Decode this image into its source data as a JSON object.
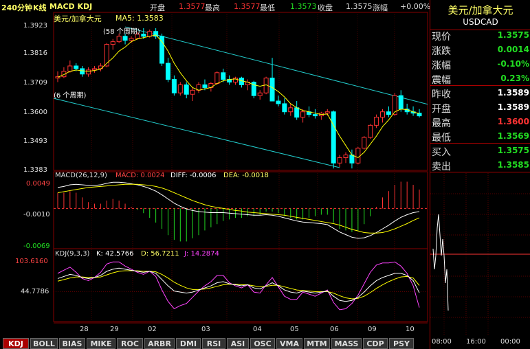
{
  "header": {
    "period": "240分钟",
    "kline": "K线",
    "indicators": "MACD KDJ",
    "open_label": "开盘",
    "open_value": "1.3577",
    "high_label": "最高",
    "high_value": "1.3577",
    "low_label": "最低",
    "low_value": "1.3573",
    "close_label": "收盘",
    "close_value": "1.3575",
    "change_label": "涨幅",
    "change_value": "+0.00%"
  },
  "main_panel": {
    "symbol_name": "美元/加拿大元",
    "ma_label": "MA5: 1.3583",
    "channel_top_label": "(58 个周期)",
    "channel_bottom_label": "(6 个周期)",
    "y_ticks": [
      "1.3923",
      "1.3816",
      "1.3709",
      "1.3600",
      "1.3493",
      "1.3383"
    ]
  },
  "macd_panel": {
    "title": "MACD(26,12,9)",
    "macd": "MACD: 0.0024",
    "diff": "DIFF: -0.0006",
    "dea": "DEA: -0.0018",
    "y_ticks": [
      "0.0049",
      "-0.0010",
      "-0.0069"
    ]
  },
  "kdj_panel": {
    "title": "KDJ(9,3,3)",
    "k": "K: 42.5766",
    "d": "D: 56.7211",
    "j": "J: 14.2874",
    "y_ticks": [
      "103.6160",
      "44.7786"
    ]
  },
  "x_axis": [
    "28",
    "29",
    "02",
    "03",
    "04",
    "05",
    "06",
    "09",
    "10"
  ],
  "quote": {
    "name": "美元/加拿大元",
    "code": "USDCAD",
    "rows": [
      {
        "label": "现价",
        "value": "1.3575",
        "color": "#22dd22"
      },
      {
        "label": "涨跌",
        "value": "0.0014",
        "color": "#22dd22"
      },
      {
        "label": "涨幅",
        "value": "-0.10%",
        "color": "#22dd22"
      },
      {
        "label": "震幅",
        "value": "0.23%",
        "color": "#22dd22"
      },
      {
        "label": "昨收",
        "value": "1.3589",
        "color": "#ffffff"
      },
      {
        "label": "开盘",
        "value": "1.3589",
        "color": "#ffffff"
      },
      {
        "label": "最高",
        "value": "1.3600",
        "color": "#ff3333"
      },
      {
        "label": "最低",
        "value": "1.3569",
        "color": "#22dd22"
      },
      {
        "label": "买入",
        "value": "1.3575",
        "color": "#22dd22"
      },
      {
        "label": "卖出",
        "value": "1.3585",
        "color": "#22dd22"
      }
    ],
    "time_labels": [
      "08:00",
      "16:00",
      "00:00"
    ]
  },
  "tabs": [
    "KDJ",
    "BOLL",
    "BIAS",
    "MIKE",
    "ROC",
    "ARBR",
    "DMI",
    "RSI",
    "ASI",
    "OSC",
    "VMA",
    "MTM",
    "MASS",
    "CDP",
    "PSY"
  ],
  "active_tab": "KDJ",
  "colors": {
    "up": "#ff3333",
    "down": "#00ffff",
    "ma": "#ffff00",
    "channel": "#22cccc",
    "macd_pos": "#ff3333",
    "macd_neg": "#22dd22",
    "diff": "#ffffff",
    "dea": "#ffff00",
    "k": "#ffffff",
    "d": "#ffff00",
    "j": "#ff44ff",
    "grid": "#880000"
  },
  "chart_data": {
    "type": "candlestick",
    "candles": [
      [
        1.3715,
        1.374,
        1.37,
        1.372
      ],
      [
        1.372,
        1.3755,
        1.3715,
        1.374
      ],
      [
        1.374,
        1.378,
        1.3735,
        1.376
      ],
      [
        1.376,
        1.377,
        1.374,
        1.375
      ],
      [
        1.375,
        1.376,
        1.372,
        1.373
      ],
      [
        1.373,
        1.3755,
        1.372,
        1.3745
      ],
      [
        1.3745,
        1.376,
        1.3735,
        1.375
      ],
      [
        1.375,
        1.377,
        1.374,
        1.376
      ],
      [
        1.376,
        1.3845,
        1.3755,
        1.384
      ],
      [
        1.384,
        1.386,
        1.382,
        1.385
      ],
      [
        1.385,
        1.388,
        1.3845,
        1.387
      ],
      [
        1.387,
        1.388,
        1.384,
        1.3855
      ],
      [
        1.3855,
        1.387,
        1.3845,
        1.3862
      ],
      [
        1.3862,
        1.3885,
        1.3858,
        1.3878
      ],
      [
        1.3878,
        1.39,
        1.386,
        1.387
      ],
      [
        1.387,
        1.3895,
        1.3865,
        1.3888
      ],
      [
        1.3888,
        1.39,
        1.386,
        1.387
      ],
      [
        1.387,
        1.388,
        1.376,
        1.377
      ],
      [
        1.377,
        1.379,
        1.37,
        1.371
      ],
      [
        1.371,
        1.3725,
        1.365,
        1.366
      ],
      [
        1.366,
        1.37,
        1.365,
        1.369
      ],
      [
        1.369,
        1.37,
        1.364,
        1.3655
      ],
      [
        1.3655,
        1.368,
        1.363,
        1.367
      ],
      [
        1.367,
        1.37,
        1.366,
        1.369
      ],
      [
        1.369,
        1.371,
        1.367,
        1.368
      ],
      [
        1.368,
        1.37,
        1.3665,
        1.3695
      ],
      [
        1.3695,
        1.374,
        1.369,
        1.3735
      ],
      [
        1.3735,
        1.375,
        1.37,
        1.371
      ],
      [
        1.371,
        1.3725,
        1.369,
        1.37
      ],
      [
        1.37,
        1.372,
        1.369,
        1.3715
      ],
      [
        1.3715,
        1.372,
        1.368,
        1.369
      ],
      [
        1.369,
        1.371,
        1.367,
        1.37
      ],
      [
        1.37,
        1.3705,
        1.364,
        1.365
      ],
      [
        1.365,
        1.367,
        1.3635,
        1.366
      ],
      [
        1.366,
        1.372,
        1.3655,
        1.3715
      ],
      [
        1.3715,
        1.379,
        1.371,
        1.363
      ],
      [
        1.363,
        1.365,
        1.361,
        1.362
      ],
      [
        1.362,
        1.364,
        1.358,
        1.359
      ],
      [
        1.359,
        1.362,
        1.3575,
        1.3605
      ],
      [
        1.3605,
        1.363,
        1.356,
        1.357
      ],
      [
        1.357,
        1.36,
        1.355,
        1.359
      ],
      [
        1.359,
        1.361,
        1.357,
        1.358
      ],
      [
        1.358,
        1.36,
        1.3565,
        1.3575
      ],
      [
        1.3575,
        1.359,
        1.356,
        1.3585
      ],
      [
        1.3585,
        1.36,
        1.3575,
        1.359
      ],
      [
        1.359,
        1.3595,
        1.338,
        1.34
      ],
      [
        1.34,
        1.343,
        1.3385,
        1.342
      ],
      [
        1.342,
        1.344,
        1.34,
        1.343
      ],
      [
        1.343,
        1.345,
        1.338,
        1.34
      ],
      [
        1.34,
        1.346,
        1.3395,
        1.3455
      ],
      [
        1.3455,
        1.35,
        1.345,
        1.3495
      ],
      [
        1.3495,
        1.3545,
        1.349,
        1.354
      ],
      [
        1.354,
        1.358,
        1.353,
        1.357
      ],
      [
        1.357,
        1.36,
        1.355,
        1.359
      ],
      [
        1.359,
        1.361,
        1.357,
        1.358
      ],
      [
        1.358,
        1.366,
        1.3575,
        1.365
      ],
      [
        1.365,
        1.367,
        1.359,
        1.36
      ],
      [
        1.36,
        1.362,
        1.358,
        1.359
      ],
      [
        1.359,
        1.361,
        1.3575,
        1.3585
      ],
      [
        1.3585,
        1.36,
        1.3569,
        1.3575
      ]
    ],
    "ma5": [
      1.3718,
      1.3728,
      1.374,
      1.3745,
      1.3742,
      1.374,
      1.3743,
      1.3748,
      1.377,
      1.379,
      1.3815,
      1.383,
      1.385,
      1.386,
      1.3865,
      1.387,
      1.3875,
      1.385,
      1.3815,
      1.377,
      1.3735,
      1.3705,
      1.368,
      1.367,
      1.3675,
      1.368,
      1.3695,
      1.3705,
      1.371,
      1.3712,
      1.3705,
      1.37,
      1.369,
      1.3685,
      1.369,
      1.368,
      1.3665,
      1.3645,
      1.362,
      1.3605,
      1.3595,
      1.359,
      1.3585,
      1.358,
      1.3582,
      1.354,
      1.35,
      1.3465,
      1.343,
      1.342,
      1.344,
      1.347,
      1.35,
      1.3535,
      1.356,
      1.359,
      1.36,
      1.3598,
      1.359,
      1.3583
    ],
    "ylim": [
      1.3383,
      1.3923
    ],
    "macd": {
      "ylim": [
        -0.0069,
        0.0049
      ],
      "diff": [
        0.004,
        0.0042,
        0.0045,
        0.0046,
        0.0045,
        0.0044,
        0.0044,
        0.0045,
        0.0048,
        0.005,
        0.005,
        0.0049,
        0.0047,
        0.0045,
        0.0042,
        0.0038,
        0.0033,
        0.0026,
        0.0018,
        0.001,
        0.0004,
        -0.0001,
        -0.0004,
        -0.0006,
        -0.0007,
        -0.0008,
        -0.0008,
        -0.0008,
        -0.0009,
        -0.001,
        -0.0011,
        -0.0012,
        -0.0013,
        -0.0013,
        -0.0012,
        -0.0013,
        -0.0015,
        -0.0018,
        -0.0021,
        -0.0024,
        -0.0026,
        -0.0027,
        -0.0028,
        -0.0029,
        -0.0031,
        -0.0038,
        -0.0045,
        -0.005,
        -0.0055,
        -0.0057,
        -0.0056,
        -0.0052,
        -0.0046,
        -0.0039,
        -0.0032,
        -0.0024,
        -0.0017,
        -0.0012,
        -0.0008,
        -0.0006
      ],
      "dea": [
        0.003,
        0.0032,
        0.0034,
        0.0036,
        0.0038,
        0.004,
        0.0041,
        0.0042,
        0.0043,
        0.0044,
        0.0045,
        0.0046,
        0.0046,
        0.0046,
        0.0045,
        0.0044,
        0.0042,
        0.0039,
        0.0035,
        0.003,
        0.0025,
        0.002,
        0.0015,
        0.0011,
        0.0007,
        0.0004,
        0.0002,
        0.0,
        -0.0002,
        -0.0004,
        -0.0005,
        -0.0007,
        -0.0008,
        -0.0009,
        -0.001,
        -0.0011,
        -0.0012,
        -0.0013,
        -0.0015,
        -0.0017,
        -0.0019,
        -0.0021,
        -0.0023,
        -0.0025,
        -0.0027,
        -0.0029,
        -0.0032,
        -0.0036,
        -0.004,
        -0.0043,
        -0.0046,
        -0.0047,
        -0.0047,
        -0.0046,
        -0.0043,
        -0.0039,
        -0.0034,
        -0.0029,
        -0.0023,
        -0.0018
      ],
      "hist": [
        0.001,
        0.001,
        0.0011,
        0.001,
        0.0007,
        0.0004,
        0.0003,
        0.0003,
        0.0005,
        0.0006,
        0.0005,
        0.0003,
        0.0001,
        -0.0001,
        -0.0003,
        -0.0006,
        -0.0009,
        -0.0013,
        -0.0017,
        -0.002,
        -0.0021,
        -0.0021,
        -0.0019,
        -0.0017,
        -0.0014,
        -0.0012,
        -0.001,
        -0.0008,
        -0.0007,
        -0.0006,
        -0.0006,
        -0.0005,
        -0.0005,
        -0.0004,
        -0.0002,
        -0.0002,
        -0.0003,
        -0.0005,
        -0.0006,
        -0.0007,
        -0.0007,
        -0.0006,
        -0.0005,
        -0.0004,
        -0.0004,
        -0.0009,
        -0.0013,
        -0.0014,
        -0.0015,
        -0.0014,
        -0.001,
        -0.0005,
        0.0001,
        0.0007,
        0.0011,
        0.0015,
        0.0017,
        0.0017,
        0.0015,
        0.0012
      ]
    },
    "kdj": {
      "ylim": [
        -10,
        103.616
      ],
      "k": [
        70,
        74,
        78,
        76,
        72,
        70,
        72,
        76,
        84,
        88,
        90,
        88,
        86,
        84,
        82,
        84,
        80,
        68,
        56,
        46,
        44,
        42,
        44,
        48,
        52,
        56,
        62,
        64,
        60,
        58,
        56,
        58,
        52,
        50,
        56,
        62,
        56,
        48,
        44,
        42,
        46,
        44,
        42,
        44,
        46,
        36,
        28,
        26,
        28,
        34,
        44,
        56,
        66,
        72,
        76,
        80,
        80,
        76,
        66,
        42.5766
      ],
      "d": [
        65,
        68,
        71,
        73,
        73,
        72,
        72,
        73,
        77,
        81,
        84,
        85,
        85,
        85,
        84,
        84,
        83,
        78,
        71,
        63,
        57,
        52,
        49,
        49,
        50,
        52,
        55,
        58,
        59,
        59,
        58,
        58,
        56,
        54,
        55,
        57,
        57,
        54,
        51,
        48,
        47,
        46,
        45,
        45,
        45,
        42,
        37,
        33,
        31,
        32,
        36,
        43,
        51,
        58,
        64,
        69,
        73,
        74,
        71,
        56.7211
      ],
      "j": [
        80,
        86,
        92,
        82,
        70,
        66,
        72,
        82,
        98,
        102,
        102,
        94,
        88,
        82,
        78,
        84,
        74,
        48,
        26,
        12,
        18,
        22,
        34,
        46,
        56,
        64,
        76,
        76,
        62,
        56,
        52,
        58,
        44,
        42,
        58,
        72,
        54,
        36,
        30,
        30,
        44,
        40,
        36,
        42,
        48,
        24,
        10,
        12,
        22,
        38,
        60,
        82,
        96,
        100,
        100,
        102,
        94,
        80,
        56,
        14.2874
      ]
    }
  }
}
